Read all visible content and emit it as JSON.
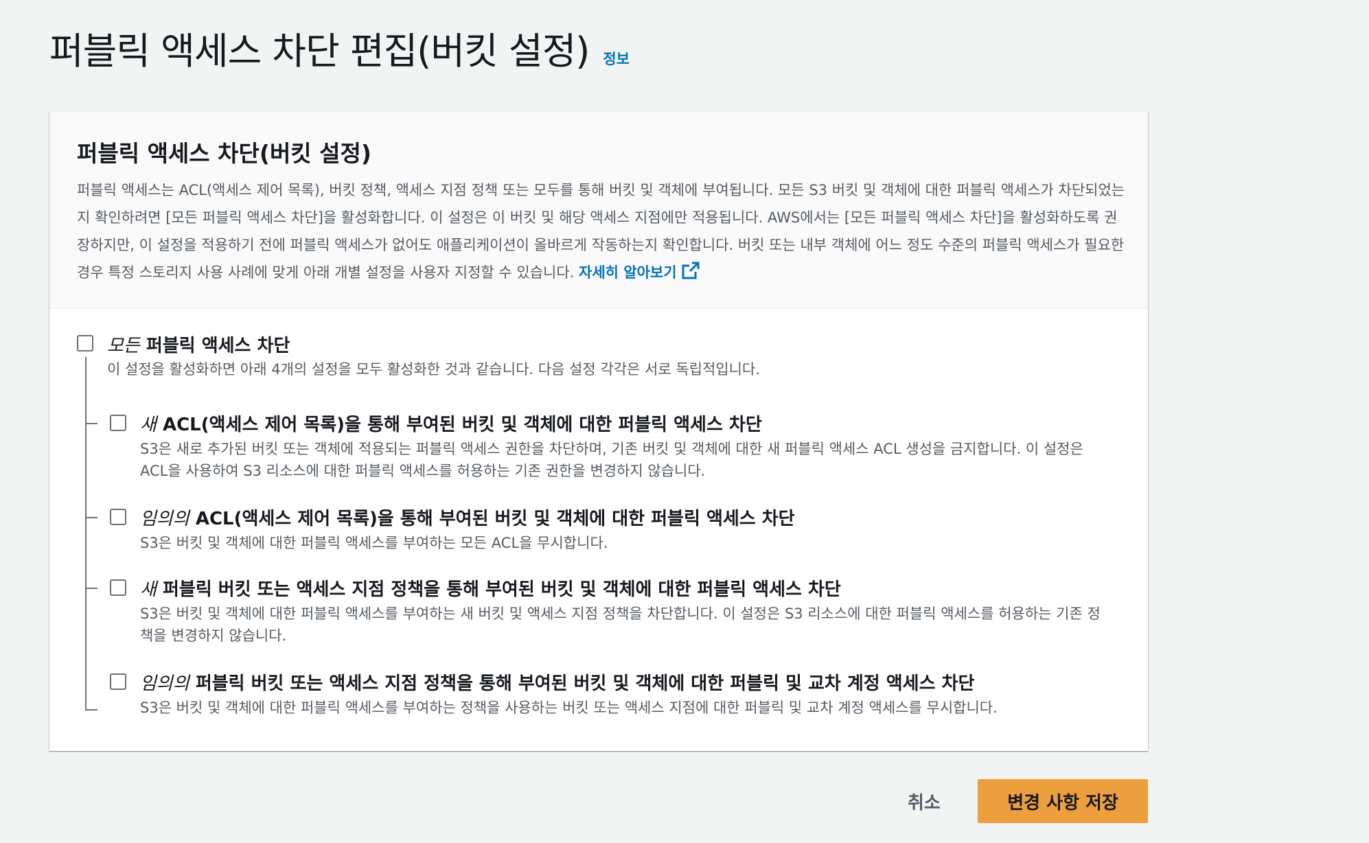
{
  "header": {
    "title": "퍼블릭 액세스 차단 편집(버킷 설정)",
    "info_link": "정보"
  },
  "panel": {
    "title": "퍼블릭 액세스 차단(버킷 설정)",
    "description": "퍼블릭 액세스는 ACL(액세스 제어 목록), 버킷 정책, 액세스 지점 정책 또는 모두를 통해 버킷 및 객체에 부여됩니다. 모든 S3 버킷 및 객체에 대한 퍼블릭 액세스가 차단되었는지 확인하려면 [모든 퍼블릭 액세스 차단]을 활성화합니다. 이 설정은 이 버킷 및 해당 액세스 지점에만 적용됩니다. AWS에서는 [모든 퍼블릭 액세스 차단]을 활성화하도록 권장하지만, 이 설정을 적용하기 전에 퍼블릭 액세스가 없어도 애플리케이션이 올바르게 작동하는지 확인합니다. 버킷 또는 내부 객체에 어느 정도 수준의 퍼블릭 액세스가 필요한 경우 특정 스토리지 사용 사례에 맞게 아래 개별 설정을 사용자 지정할 수 있습니다. ",
    "learn_more": "자세히 알아보기"
  },
  "options": {
    "all": {
      "emphasis": "모든",
      "label": " 퍼블릭 액세스 차단",
      "description": "이 설정을 활성화하면 아래 4개의 설정을 모두 활성화한 것과 같습니다. 다음 설정 각각은 서로 독립적입니다.",
      "checked": false
    },
    "items": [
      {
        "emphasis": "새",
        "label": " ACL(액세스 제어 목록)을 통해 부여된 버킷 및 객체에 대한 퍼블릭 액세스 차단",
        "description": "S3은 새로 추가된 버킷 또는 객체에 적용되는 퍼블릭 액세스 권한을 차단하며, 기존 버킷 및 객체에 대한 새 퍼블릭 액세스 ACL 생성을 금지합니다. 이 설정은 ACL을 사용하여 S3 리소스에 대한 퍼블릭 액세스를 허용하는 기존 권한을 변경하지 않습니다.",
        "checked": false
      },
      {
        "emphasis": "임의의",
        "label": " ACL(액세스 제어 목록)을 통해 부여된 버킷 및 객체에 대한 퍼블릭 액세스 차단",
        "description": "S3은 버킷 및 객체에 대한 퍼블릭 액세스를 부여하는 모든 ACL을 무시합니다.",
        "checked": false
      },
      {
        "emphasis": "새",
        "label": " 퍼블릭 버킷 또는 액세스 지점 정책을 통해 부여된 버킷 및 객체에 대한 퍼블릭 액세스 차단",
        "description": "S3은 버킷 및 객체에 대한 퍼블릭 액세스를 부여하는 새 버킷 및 액세스 지점 정책을 차단합니다. 이 설정은 S3 리소스에 대한 퍼블릭 액세스를 허용하는 기존 정책을 변경하지 않습니다.",
        "checked": false
      },
      {
        "emphasis": "임의의",
        "label": " 퍼블릭 버킷 또는 액세스 지점 정책을 통해 부여된 버킷 및 객체에 대한 퍼블릭 및 교차 계정 액세스 차단",
        "description": "S3은 버킷 및 객체에 대한 퍼블릭 액세스를 부여하는 정책을 사용하는 버킷 또는 액세스 지점에 대한 퍼블릭 및 교차 계정 액세스를 무시합니다.",
        "checked": false
      }
    ]
  },
  "footer": {
    "cancel_label": "취소",
    "save_label": "변경 사항 저장"
  },
  "colors": {
    "link": "#0073bb",
    "primary_button": "#ec9f3c",
    "background": "#f2f3f3"
  }
}
